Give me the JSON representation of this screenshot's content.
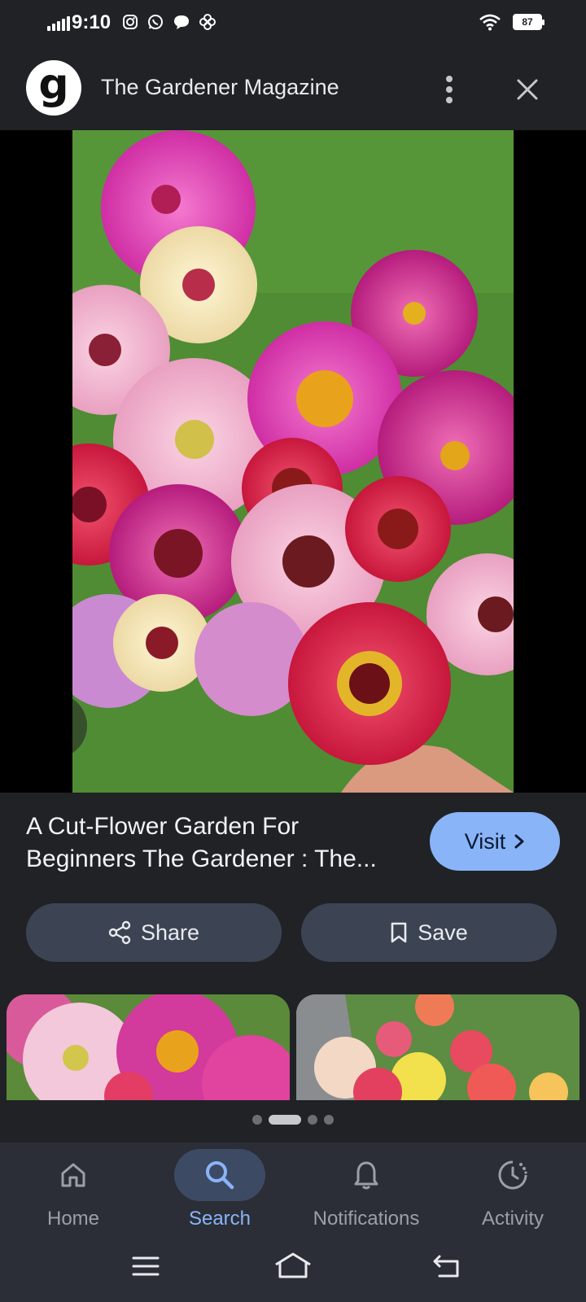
{
  "status_bar": {
    "time": "9:10",
    "battery": "87",
    "left_icons": [
      "instagram-icon",
      "whatsapp-icon",
      "chat-bubble-icon",
      "pinwheel-icon"
    ],
    "right_icons": [
      "wifi-icon",
      "battery-icon"
    ]
  },
  "header": {
    "site_initial": "g",
    "site_title": "The Gardener Magazine",
    "more_icon": "more-vert-icon",
    "close_icon": "close-icon"
  },
  "result": {
    "title": "A Cut-Flower Garden For Beginners The Gardener : The...",
    "visit_label": "Visit",
    "share_label": "Share",
    "save_label": "Save"
  },
  "pager": {
    "count": 4,
    "active": 1
  },
  "bottom_nav": {
    "items": [
      {
        "label": "Home",
        "icon": "home-icon"
      },
      {
        "label": "Search",
        "icon": "search-icon"
      },
      {
        "label": "Notifications",
        "icon": "bell-icon"
      },
      {
        "label": "Activity",
        "icon": "activity-icon"
      }
    ],
    "active": 1
  },
  "colors": {
    "background": "#202226",
    "accent": "#8ab4f8",
    "pill": "#3c4454",
    "nav_bg": "#2b2e36"
  }
}
